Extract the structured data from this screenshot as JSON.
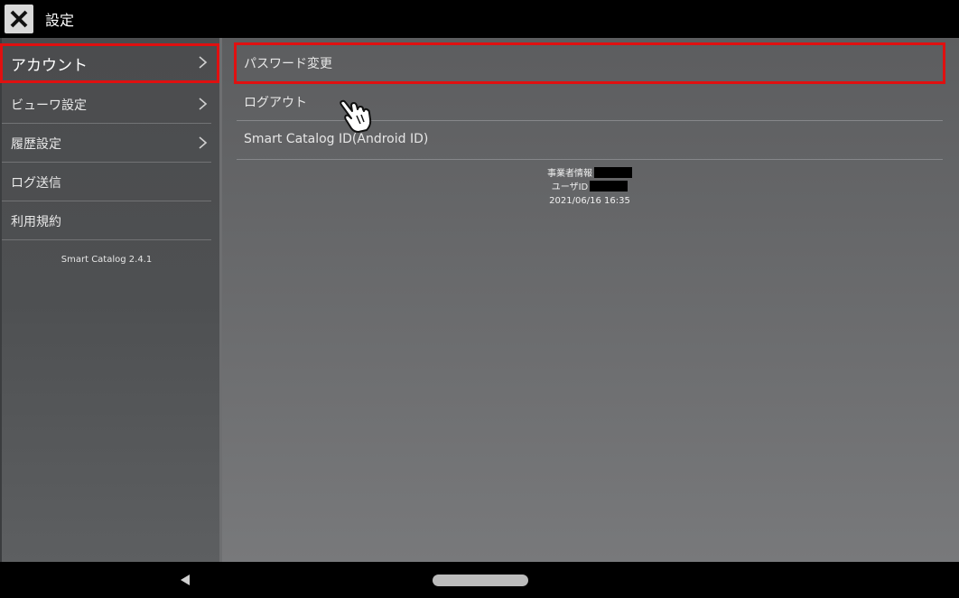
{
  "header": {
    "title": "設定",
    "close_icon": "close-icon"
  },
  "sidebar": {
    "items": [
      {
        "label": "アカウント",
        "has_chevron": true,
        "selected": true
      },
      {
        "label": "ビューワ設定",
        "has_chevron": true
      },
      {
        "label": "履歴設定",
        "has_chevron": true
      },
      {
        "label": "ログ送信",
        "has_chevron": false
      },
      {
        "label": "利用規約",
        "has_chevron": false
      }
    ],
    "version": "Smart Catalog 2.4.1"
  },
  "account": {
    "rows": [
      {
        "label": "パスワード変更"
      },
      {
        "label": "ログアウト"
      },
      {
        "label": "Smart Catalog ID(Android ID)"
      }
    ],
    "info": {
      "business_label": "事業者情報",
      "user_label": "ユーザID",
      "datetime": "2021/06/16 16:35"
    }
  },
  "colors": {
    "highlight": "#e01010"
  }
}
